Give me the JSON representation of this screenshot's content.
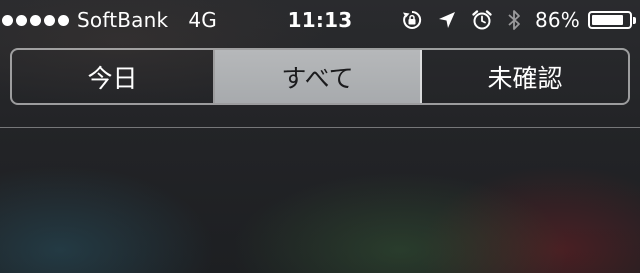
{
  "status_bar": {
    "signal_bars": 5,
    "carrier": "SoftBank",
    "network": "4G",
    "time": "11:13",
    "battery_percent": "86%",
    "battery_level": 0.86,
    "icons": [
      "rotation-lock-icon",
      "location-arrow-icon",
      "alarm-clock-icon",
      "bluetooth-icon",
      "battery-icon"
    ]
  },
  "tabs": [
    {
      "label": "今日",
      "selected": false
    },
    {
      "label": "すべて",
      "selected": true
    },
    {
      "label": "未確認",
      "selected": false
    }
  ],
  "colors": {
    "selected_segment": "#aeb0b3",
    "text": "#ffffff",
    "selected_text": "#1b1b1d"
  }
}
